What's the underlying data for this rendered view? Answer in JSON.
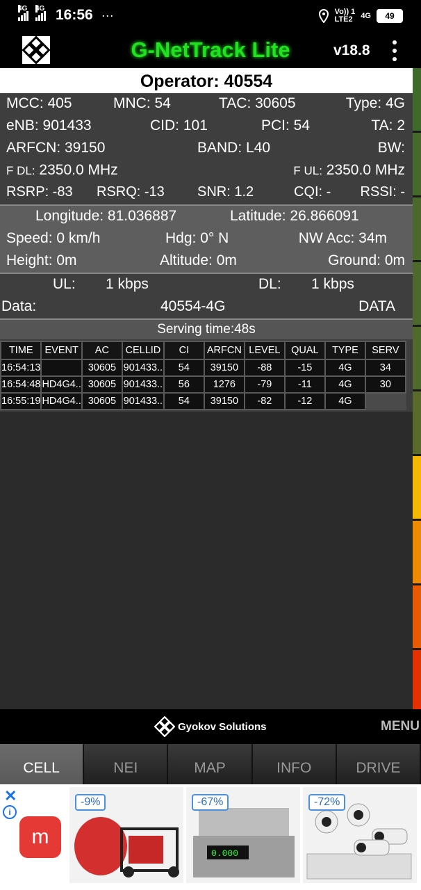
{
  "status": {
    "time": "16:56",
    "net1": "4G",
    "net2": "4G",
    "volte": "Vo)) 1",
    "lte": "LTE2",
    "net3": "4G",
    "battery": "49",
    "dots": "···"
  },
  "header": {
    "title": "G-NetTrack Lite",
    "version": "v18.8"
  },
  "operator": "Operator: 40554",
  "cell": {
    "mcc": "MCC: 405",
    "mnc": "MNC: 54",
    "tac": "TAC: 30605",
    "type": "Type: 4G",
    "enb": "eNB: 901433",
    "cid": "CID: 101",
    "pci": "PCI: 54",
    "ta": "TA: 2",
    "arfcn": "ARFCN: 39150",
    "band": "BAND: L40",
    "bw": "BW:",
    "fdl_label": "F DL:",
    "fdl_value": "2350.0 MHz",
    "ful_label": "F UL:",
    "ful_value": "2350.0 MHz",
    "rsrp": "RSRP: -83",
    "rsrq": "RSRQ: -13",
    "snr": "SNR: 1.2",
    "cqi": "CQI: -",
    "rssi": "RSSI: -"
  },
  "location": {
    "longitude": "Longitude: 81.036887",
    "latitude": "Latitude: 26.866091",
    "speed": "Speed: 0 km/h",
    "hdg": "Hdg: 0° N",
    "nwacc": "NW Acc: 34m",
    "height": "Height: 0m",
    "altitude": "Altitude: 0m",
    "ground": "Ground: 0m"
  },
  "throughput": {
    "ul_label": "UL:",
    "ul_value": "1 kbps",
    "dl_label": "DL:",
    "dl_value": "1 kbps",
    "data_label": "Data:",
    "data_value": "40554-4G",
    "data_state": "DATA"
  },
  "serving_time": "Serving time:48s",
  "events_table": {
    "headers": [
      "TIME",
      "EVENT",
      "AC",
      "CELLID",
      "CI",
      "ARFCN",
      "LEVEL",
      "QUAL",
      "TYPE",
      "SERV"
    ],
    "rows": [
      [
        "16:54:13",
        "",
        "30605",
        "901433..",
        "54",
        "39150",
        "-88",
        "-15",
        "4G",
        "34"
      ],
      [
        "16:54:48",
        "HD4G4..",
        "30605",
        "901433..",
        "56",
        "1276",
        "-79",
        "-11",
        "4G",
        "30"
      ],
      [
        "16:55:19",
        "HD4G4..",
        "30605",
        "901433..",
        "54",
        "39150",
        "-82",
        "-12",
        "4G",
        ""
      ]
    ]
  },
  "signal_strip_colors": [
    "#3f6b2a",
    "#466a2c",
    "#4a6a2c",
    "#4d6a2c",
    "#506a2c",
    "#5a6a2a",
    "#f5b800",
    "#f08a00",
    "#ea5a00",
    "#e63000",
    "#e00000"
  ],
  "footer": {
    "brand": "Gyokov Solutions",
    "menu": "MENU"
  },
  "tabs": [
    {
      "label": "CELL",
      "active": true
    },
    {
      "label": "NEI",
      "active": false
    },
    {
      "label": "MAP",
      "active": false
    },
    {
      "label": "INFO",
      "active": false
    },
    {
      "label": "DRIVE",
      "active": false
    }
  ],
  "ad": {
    "close": "✕",
    "info": "i",
    "app_logo": "m",
    "discounts": [
      "-9%",
      "-67%",
      "-72%"
    ]
  }
}
